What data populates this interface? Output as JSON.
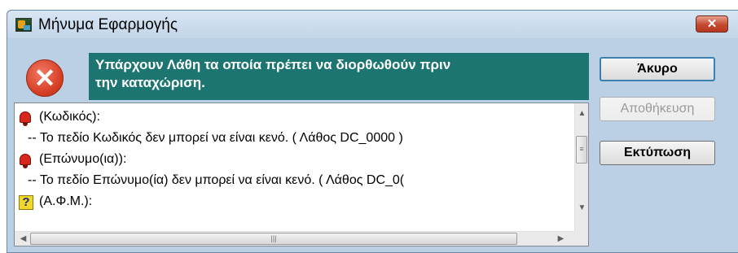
{
  "window": {
    "title": "Μήνυμα Εφαρμογής",
    "close_label": "✕"
  },
  "error": {
    "icon": "error-x-icon",
    "message": "Υπάρχουν Λάθη τα οποία πρέπει  να διορθωθούν πριν\nτην καταχώριση."
  },
  "buttons": {
    "cancel": "Άκυρο",
    "save": "Αποθήκευση",
    "print": "Εκτύπωση"
  },
  "list": {
    "items": [
      {
        "icon": "red-bell-icon",
        "text": "(Κωδικός):"
      },
      {
        "text": "-- Το πεδίο  Κωδικός δεν μπορεί να είναι κενό. ( Λάθος DC_0000 )"
      },
      {
        "icon": "red-bell-icon",
        "text": "(Επώνυμο(ια)):"
      },
      {
        "text": "-- Το πεδίο  Επώνυμο(ία) δεν μπορεί να είναι κενό. ( Λάθος DC_0("
      },
      {
        "icon": "question-icon",
        "text": "(Α.Φ.Μ.):"
      }
    ]
  },
  "colors": {
    "message_bg": "#1c7571",
    "error_red": "#d63d24",
    "window_bg": "#bcd0e5"
  }
}
